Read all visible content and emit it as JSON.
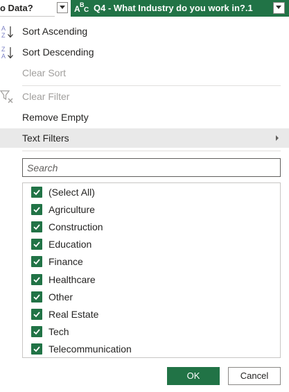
{
  "header": {
    "left_column_title": "o Data?",
    "column_type_icon": "abc-text-type-icon",
    "column_type_letters": {
      "a": "A",
      "b": "B",
      "c": "C"
    },
    "column_title": "Q4 - What Industry do you work in?.1",
    "accent_color": "#217346"
  },
  "menu": {
    "sort_ascending": "Sort Ascending",
    "sort_descending": "Sort Descending",
    "clear_sort": "Clear Sort",
    "clear_filter": "Clear Filter",
    "remove_empty": "Remove Empty",
    "text_filters": "Text Filters"
  },
  "search": {
    "placeholder": "Search",
    "value": ""
  },
  "filter_list": {
    "items": [
      {
        "label": "(Select All)",
        "checked": true
      },
      {
        "label": "Agriculture",
        "checked": true
      },
      {
        "label": "Construction",
        "checked": true
      },
      {
        "label": "Education",
        "checked": true
      },
      {
        "label": "Finance",
        "checked": true
      },
      {
        "label": "Healthcare",
        "checked": true
      },
      {
        "label": "Other",
        "checked": true
      },
      {
        "label": "Real Estate",
        "checked": true
      },
      {
        "label": "Tech",
        "checked": true
      },
      {
        "label": "Telecommunication",
        "checked": true
      }
    ]
  },
  "buttons": {
    "ok": "OK",
    "cancel": "Cancel"
  }
}
